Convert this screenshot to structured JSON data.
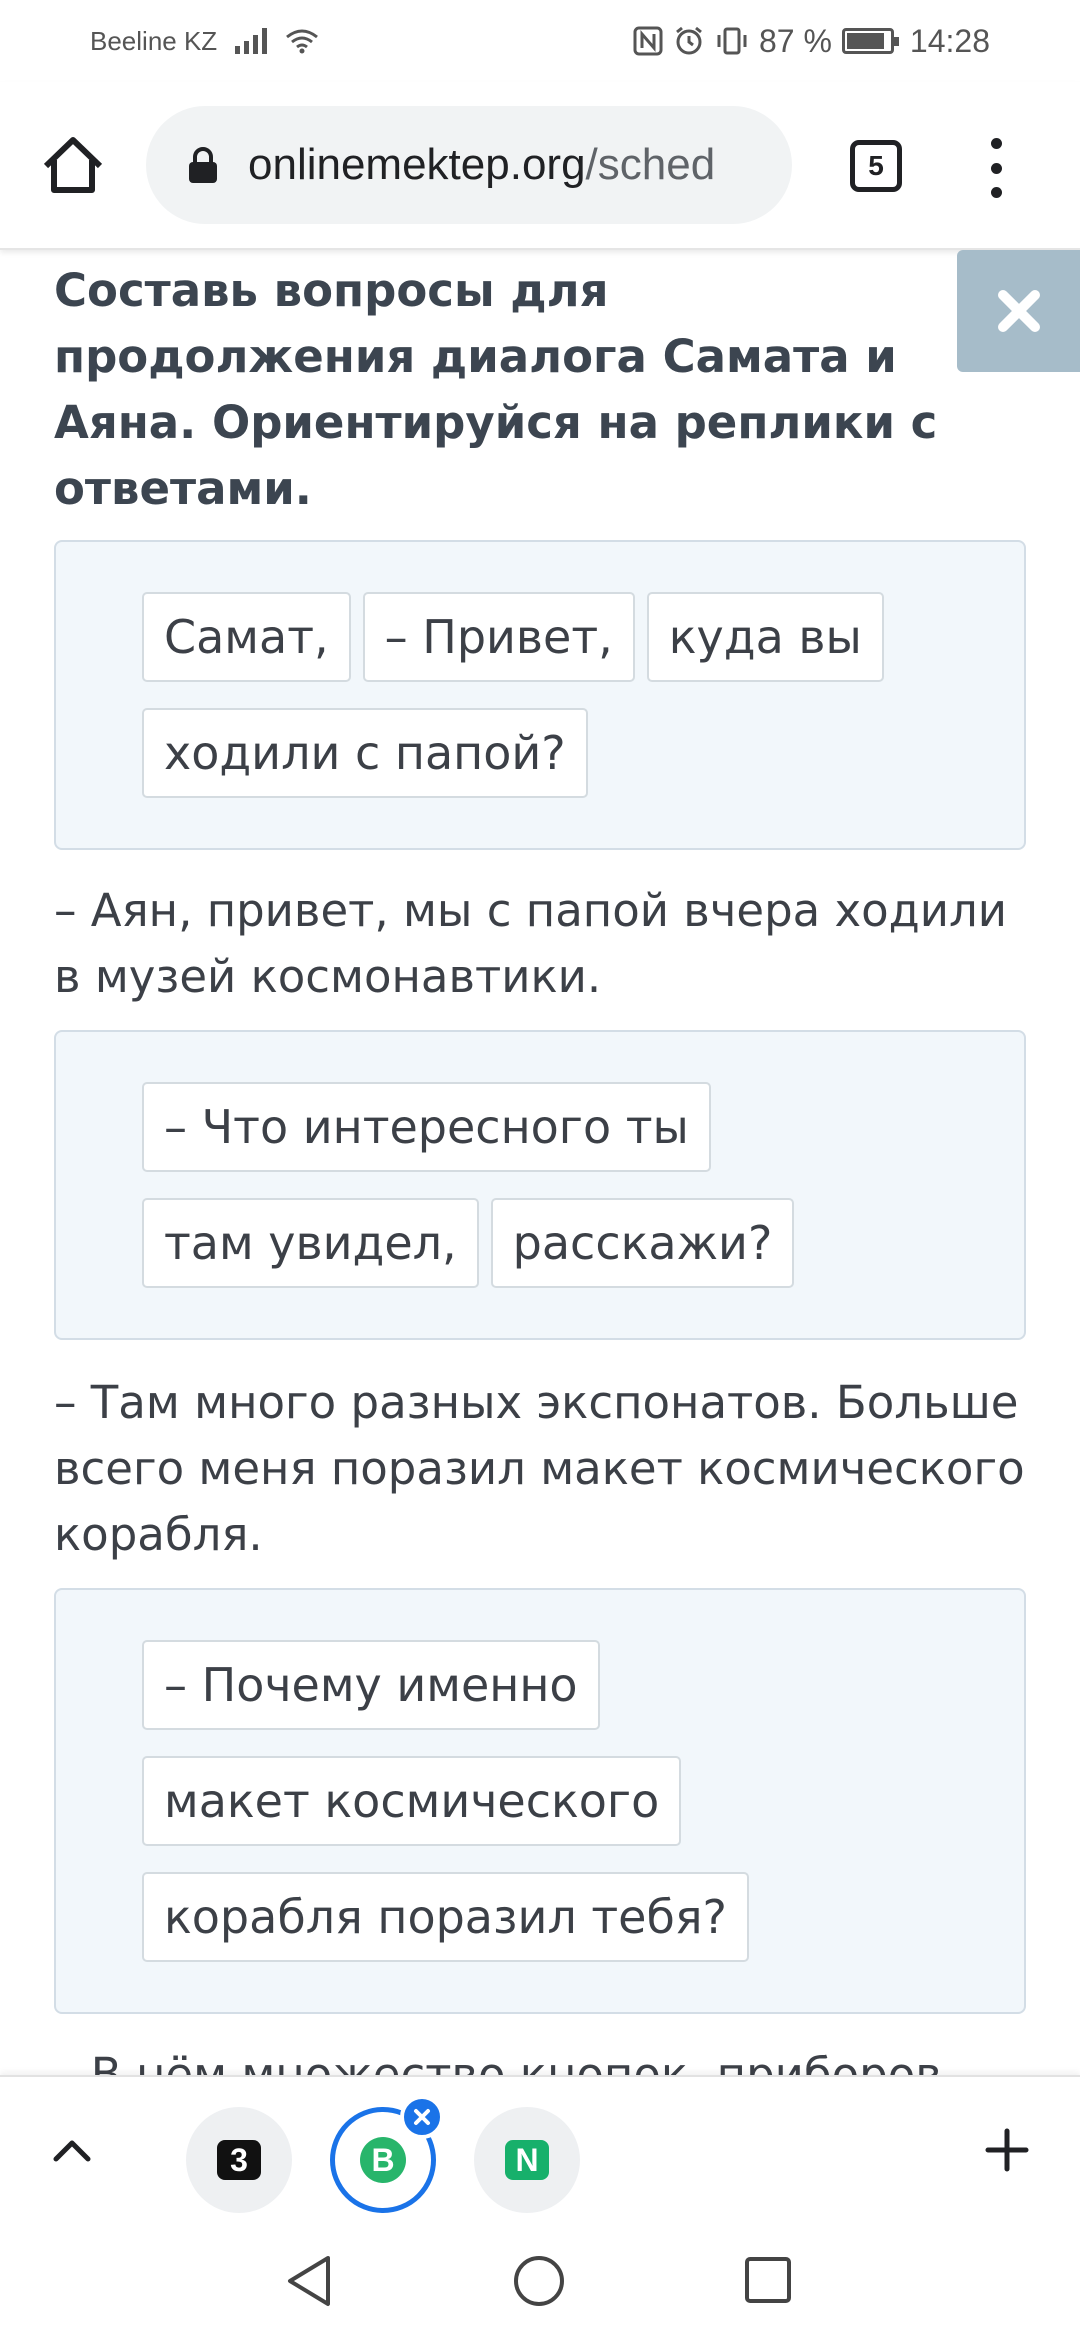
{
  "status_bar": {
    "carrier": "Beeline KZ",
    "battery": "87 %",
    "time": "14:28",
    "battery_level": 0.87
  },
  "browser": {
    "url_domain": "onlinemektep.org",
    "url_path": "/sched",
    "tab_count": "5",
    "icons": [
      "home-icon",
      "lock-icon",
      "tab-switcher-icon",
      "overflow-menu-icon"
    ]
  },
  "lesson": {
    "title": "Составь вопросы для продолжения диалога Самата и Аяна. Ориентируйся на реплики с ответами.",
    "tasks": [
      {
        "chips": [
          "Самат,",
          "– Привет,",
          "куда вы",
          "ходили с папой?"
        ]
      },
      {
        "chips": [
          "– Что интересного ты",
          "там увидел,",
          "расскажи?"
        ]
      },
      {
        "chips": [
          "– Почему именно",
          "макет космического",
          "корабля поразил тебя?"
        ]
      }
    ],
    "replies": [
      "– Аян, привет, мы с папой вчера ходили в музей космонавтики.",
      "– Там много разных экспонатов. Больше всего меня поразил макет космического корабля.",
      "– В нём множество кнопок, приборов"
    ]
  },
  "bottom_bar": {
    "tabs": [
      {
        "label": "3",
        "color": "#111111",
        "fg": "#ffffff",
        "accent": "#33c59a"
      },
      {
        "label": "B",
        "color": "#28b56b",
        "fg": "#ffffff",
        "accent": "#28b56b"
      },
      {
        "label": "N",
        "color": "#17b06b",
        "fg": "#ffffff",
        "accent": "#17b06b"
      }
    ]
  },
  "colors": {
    "accent": "#1a73e8",
    "close_button": "#a6bcc9",
    "task_background": "#f2f7fb"
  }
}
